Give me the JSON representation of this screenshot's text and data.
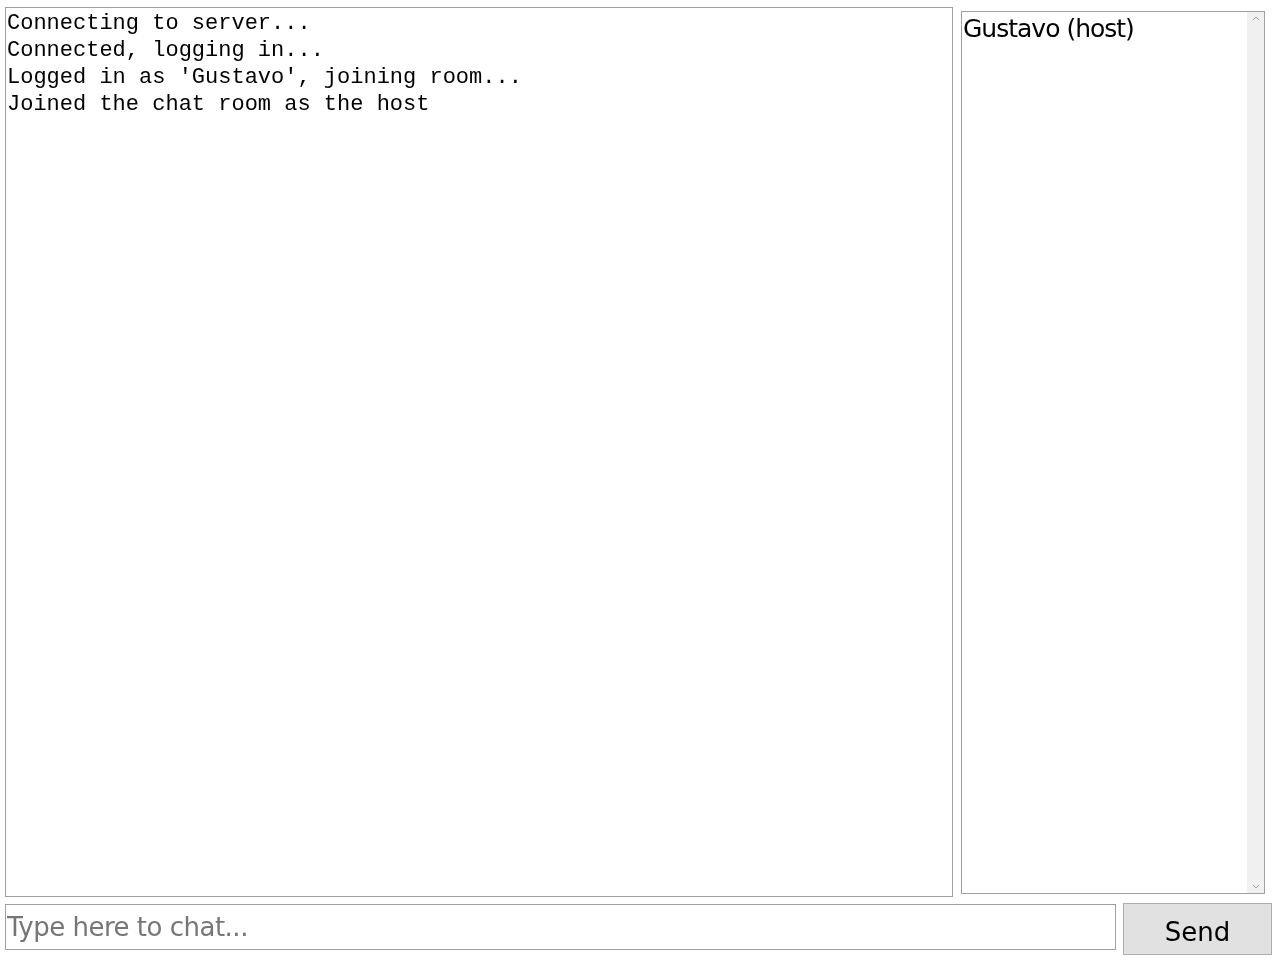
{
  "chat_log": {
    "lines": [
      "Connecting to server...",
      "Connected, logging in...",
      "Logged in as 'Gustavo', joining room...",
      "Joined the chat room as the host"
    ]
  },
  "user_list": {
    "users": [
      "Gustavo (host)"
    ]
  },
  "message_input": {
    "placeholder": "Type here to chat..."
  },
  "send_button": {
    "label": "Send"
  }
}
